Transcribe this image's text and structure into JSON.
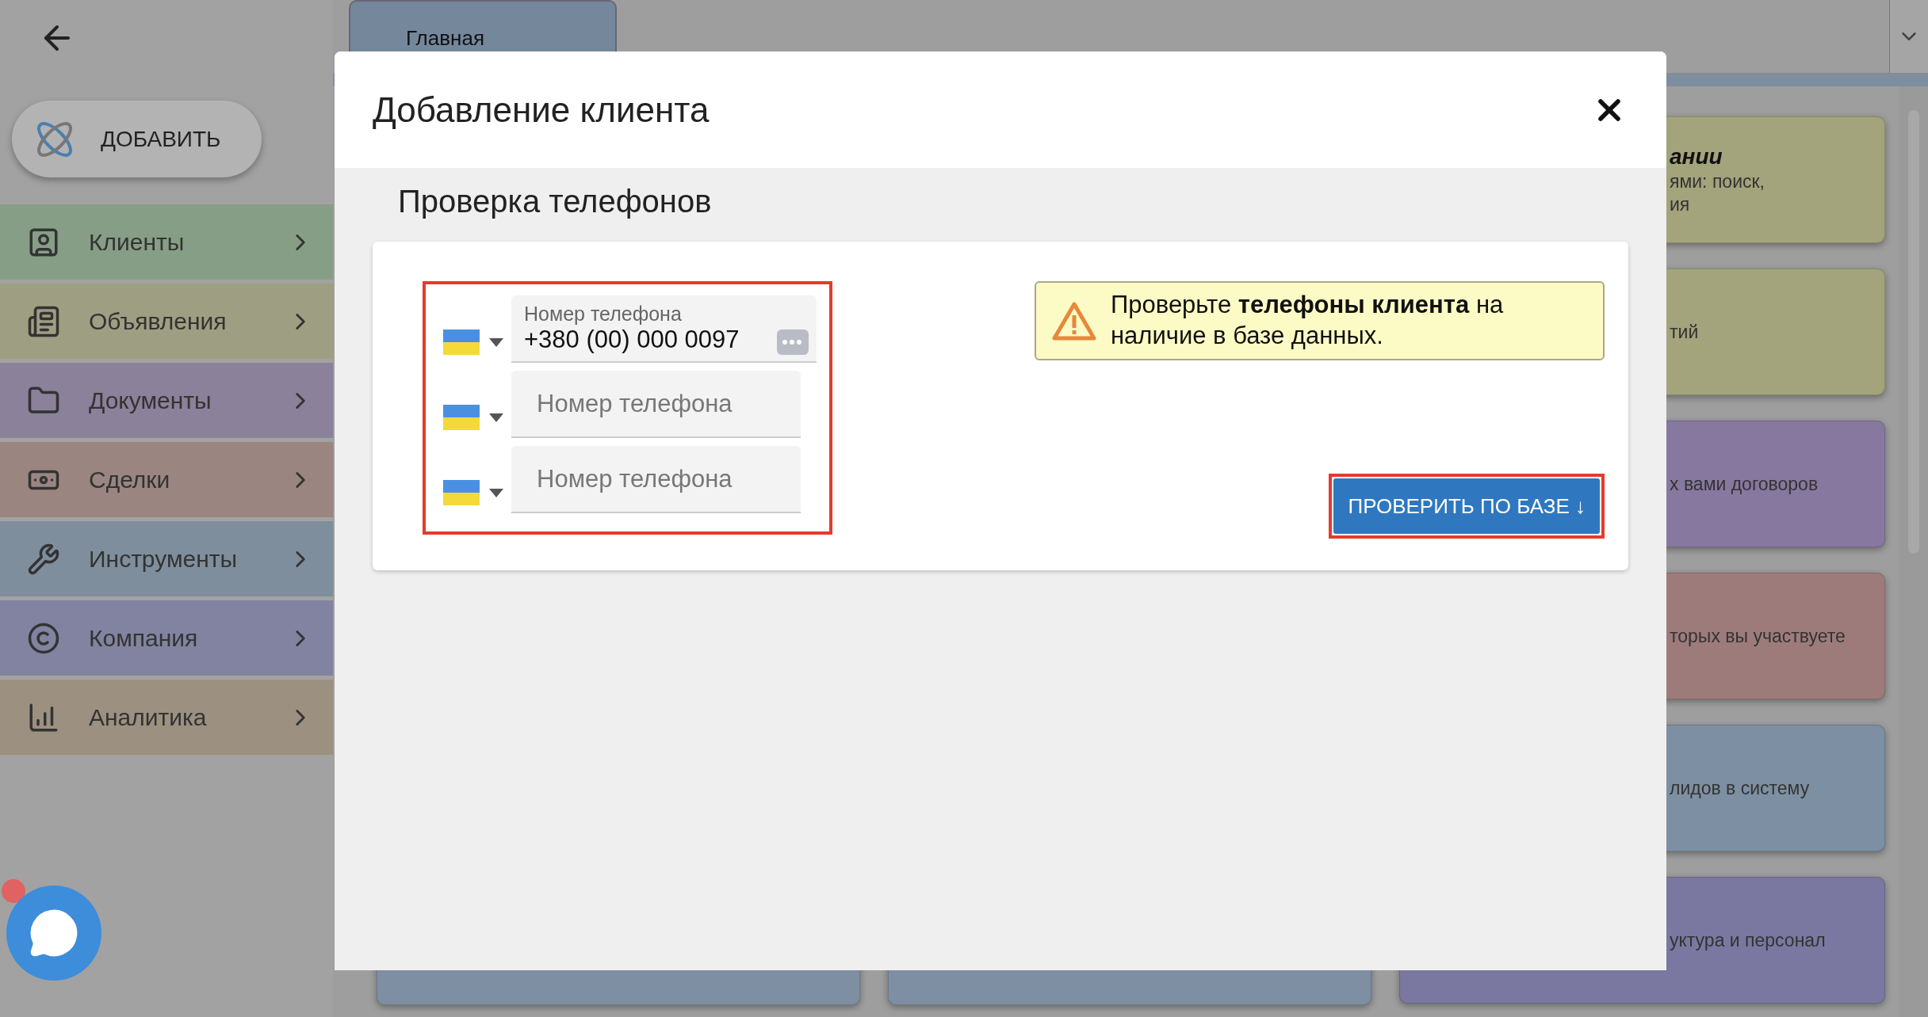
{
  "sidebar": {
    "add_button": "ДОБАВИТЬ",
    "items": [
      {
        "label": "Клиенты",
        "kind": "clients",
        "color": "#869e86"
      },
      {
        "label": "Объявления",
        "kind": "ads",
        "color": "#9e9e82"
      },
      {
        "label": "Документы",
        "kind": "documents",
        "color": "#8b819a"
      },
      {
        "label": "Сделки",
        "kind": "deals",
        "color": "#9a8581"
      },
      {
        "label": "Инструменты",
        "kind": "tools",
        "color": "#7f8e9c"
      },
      {
        "label": "Компания",
        "kind": "company",
        "color": "#8183a0"
      },
      {
        "label": "Аналитика",
        "kind": "analytics",
        "color": "#9c9080"
      }
    ]
  },
  "tabs": [
    {
      "label": "Главная",
      "selected": true
    }
  ],
  "cards": [
    {
      "title": "ании",
      "lines": [
        "ями: поиск,",
        "ия"
      ],
      "color": "#a3a37c"
    },
    {
      "lines": [
        "тий"
      ],
      "color": "#a3a37c"
    },
    {
      "lines": [
        "х вами договоров"
      ],
      "color": "#8778a0"
    },
    {
      "lines": [
        "торых вы участвуете"
      ],
      "color": "#9e7b7b"
    },
    {
      "lines": [
        "лидов в систему"
      ],
      "color": "#7d8fa2"
    },
    {
      "lines": [
        "уктура и персонал"
      ],
      "color": "#7a78a0"
    }
  ],
  "modal": {
    "title": "Добавление клиента",
    "subtitle": "Проверка телефонов",
    "phones": [
      {
        "label": "Номер телефона",
        "value": "+380 (00) 000 0097"
      },
      {
        "placeholder": "Номер телефона"
      },
      {
        "placeholder": "Номер телефона"
      }
    ],
    "alert": "Проверьте **телефоны клиента** на наличие в базе данных.",
    "check_button": "ПРОВЕРИТЬ ПО БАЗЕ ↓"
  }
}
